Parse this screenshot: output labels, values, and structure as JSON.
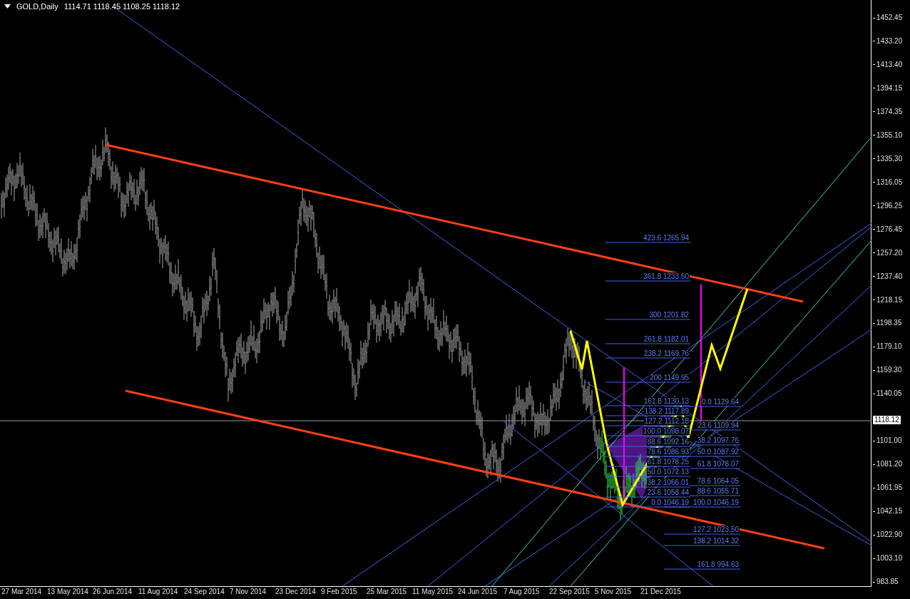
{
  "header": {
    "symbol": "GOLD,Daily",
    "quote": "1114.71 1118.45 1108.25 1118.12"
  },
  "fib_extension": [
    {
      "ratio": "423.6",
      "price": "1265.94"
    },
    {
      "ratio": "361.8",
      "price": "1233.60"
    },
    {
      "ratio": "300",
      "price": "1201.82"
    },
    {
      "ratio": "261.8",
      "price": "1182.01"
    },
    {
      "ratio": "238.2",
      "price": "1169.76"
    },
    {
      "ratio": "200",
      "price": "1149.95"
    }
  ],
  "fib_retracement_left": [
    {
      "ratio": "161.8",
      "price": "1130.13"
    },
    {
      "ratio": "138.2",
      "price": "1117.89"
    },
    {
      "ratio": "127.2",
      "price": "1112.18"
    },
    {
      "ratio": "100.0",
      "price": "1098.07"
    },
    {
      "ratio": "88.6",
      "price": "1092.16"
    },
    {
      "ratio": "78.6",
      "price": "1086.93"
    },
    {
      "ratio": "61.8",
      "price": "1078.25"
    },
    {
      "ratio": "50.0",
      "price": "1072.13"
    },
    {
      "ratio": "38.2",
      "price": "1066.01"
    },
    {
      "ratio": "23.6",
      "price": "1058.44"
    },
    {
      "ratio": "0.0",
      "price": "1046.19"
    }
  ],
  "fib_retracement_right": [
    {
      "ratio": "0.0",
      "price": "1129.64"
    },
    {
      "ratio": "23.6",
      "price": "1109.94"
    },
    {
      "ratio": "38.2",
      "price": "1097.76"
    },
    {
      "ratio": "50.0",
      "price": "1087.92"
    },
    {
      "ratio": "61.8",
      "price": "1078.07"
    },
    {
      "ratio": "78.6",
      "price": "1064.05"
    },
    {
      "ratio": "88.6",
      "price": "1055.71"
    },
    {
      "ratio": "100.0",
      "price": "1046.19"
    },
    {
      "ratio": "127.2",
      "price": "1023.50"
    },
    {
      "ratio": "138.2",
      "price": "1014.32"
    },
    {
      "ratio": "161.8",
      "price": "994.63"
    }
  ],
  "price_axis": {
    "ticks": [
      "1452.45",
      "1433.20",
      "1413.40",
      "1394.15",
      "1374.35",
      "1355.10",
      "1335.30",
      "1316.05",
      "1296.25",
      "1276.45",
      "1257.20",
      "1237.40",
      "1218.15",
      "1198.35",
      "1179.10",
      "1159.30",
      "1140.05",
      "1101.00",
      "1081.20",
      "1061.95",
      "1042.15",
      "1022.90",
      "1003.10",
      "983.85"
    ],
    "current_price": "1118.12"
  },
  "time_axis": {
    "labels": [
      "27 Mar 2014",
      "13 May 2014",
      "26 Jun 2014",
      "11 Aug 2014",
      "24 Sep 2014",
      "7 Nov 2014",
      "23 Dec 2014",
      "9 Feb 2015",
      "25 Mar 2015",
      "11 May 2015",
      "24 Jun 2015",
      "7 Aug 2015",
      "22 Sep 2015",
      "5 Nov 2015",
      "21 Dec 2015"
    ]
  }
}
